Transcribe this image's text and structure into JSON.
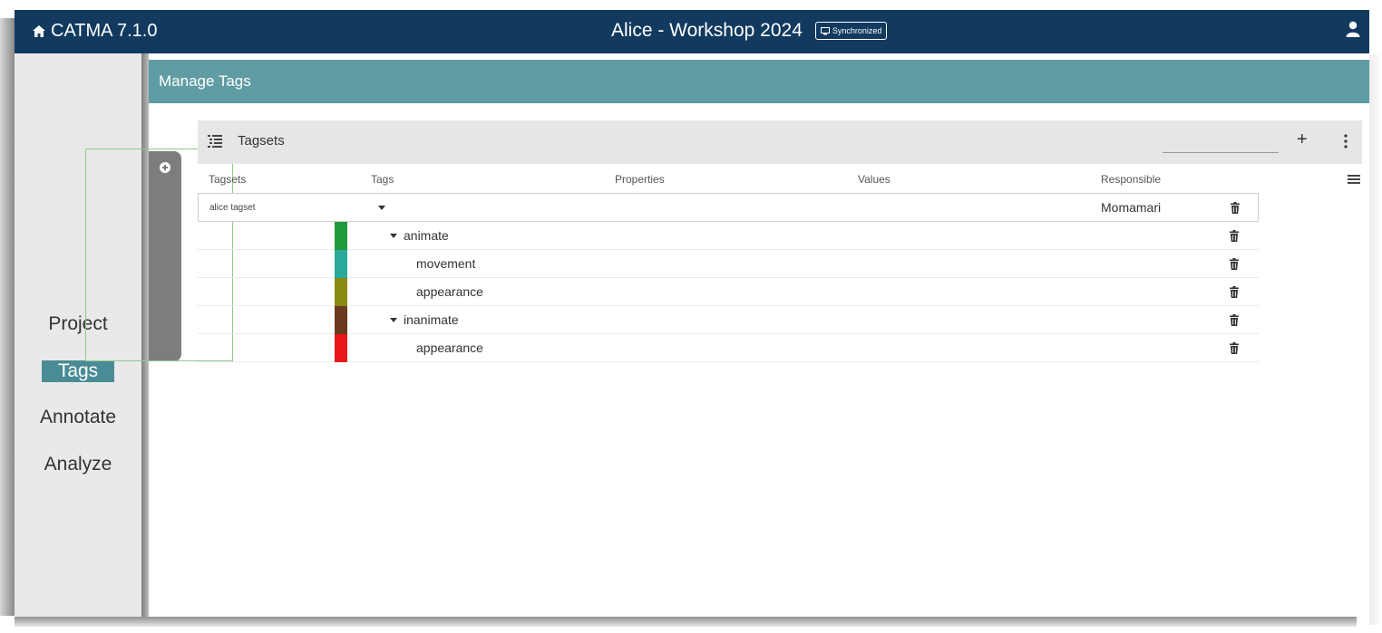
{
  "header": {
    "brand": "CATMA 7.1.0",
    "title": "Alice - Workshop 2024",
    "sync_status": "Synchronized",
    "icons": {
      "home": "home-icon",
      "user": "user-icon",
      "sync": "monitor-icon"
    }
  },
  "sidebar": {
    "items": [
      {
        "label": "Project",
        "active": false
      },
      {
        "label": "Tags",
        "active": true
      },
      {
        "label": "Annotate",
        "active": false
      },
      {
        "label": "Analyze",
        "active": false
      }
    ]
  },
  "page": {
    "title": "Manage Tags"
  },
  "tagsets_panel": {
    "title": "Tagsets",
    "search_placeholder": "",
    "columns": [
      "Tagsets",
      "Tags",
      "Properties",
      "Values",
      "Responsible"
    ],
    "tagset": {
      "name": "alice tagset",
      "responsible": "Momamari"
    },
    "tags": [
      {
        "label": "animate",
        "color": "#1e9a3a",
        "expandable": true,
        "level": 0
      },
      {
        "label": "movement",
        "color": "#2aaa9a",
        "expandable": false,
        "level": 1
      },
      {
        "label": "appearance",
        "color": "#8a8a12",
        "expandable": false,
        "level": 1
      },
      {
        "label": "inanimate",
        "color": "#6b3a1e",
        "expandable": true,
        "level": 0
      },
      {
        "label": "appearance",
        "color": "#e8161b",
        "expandable": false,
        "level": 1
      }
    ]
  },
  "colors": {
    "topbar": "#123a5f",
    "accent": "#4a8c96",
    "header_band": "#5f9ca3"
  }
}
